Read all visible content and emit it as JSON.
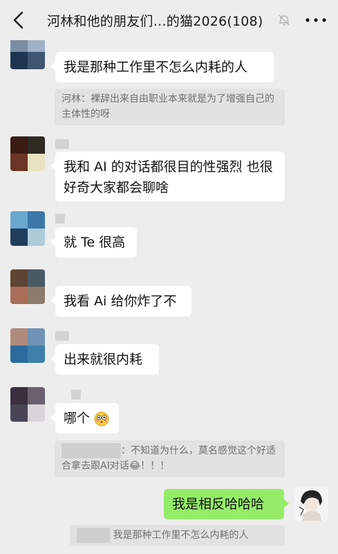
{
  "header": {
    "title": "河林和他的朋友们…的猫2026(108)",
    "back_icon": "chevron-left-icon",
    "mute_icon": "bell-off-icon",
    "more_icon": "more-icon"
  },
  "messages": [
    {
      "text": "我是那种工作里不怎么内耗的人"
    },
    {
      "text": "我和 AI 的对话都很目的性强烈 也很好奇大家都会聊啥"
    },
    {
      "text": "就 Te 很高"
    },
    {
      "text": "我看 Ai 给你炸了不"
    },
    {
      "text": "出来就很内耗"
    },
    {
      "text": "哪个"
    },
    {
      "text": "我是相反哈哈哈"
    }
  ],
  "quotes": [
    {
      "text": "河林：裸辞出来自由职业本来就是为了增强自己的主体性的呀"
    },
    {
      "text": "：不知道为什么，莫名感觉这个好适合拿去跟AI对话😂！！！"
    },
    {
      "text": "我是那种工作里不怎么内耗的人"
    }
  ]
}
